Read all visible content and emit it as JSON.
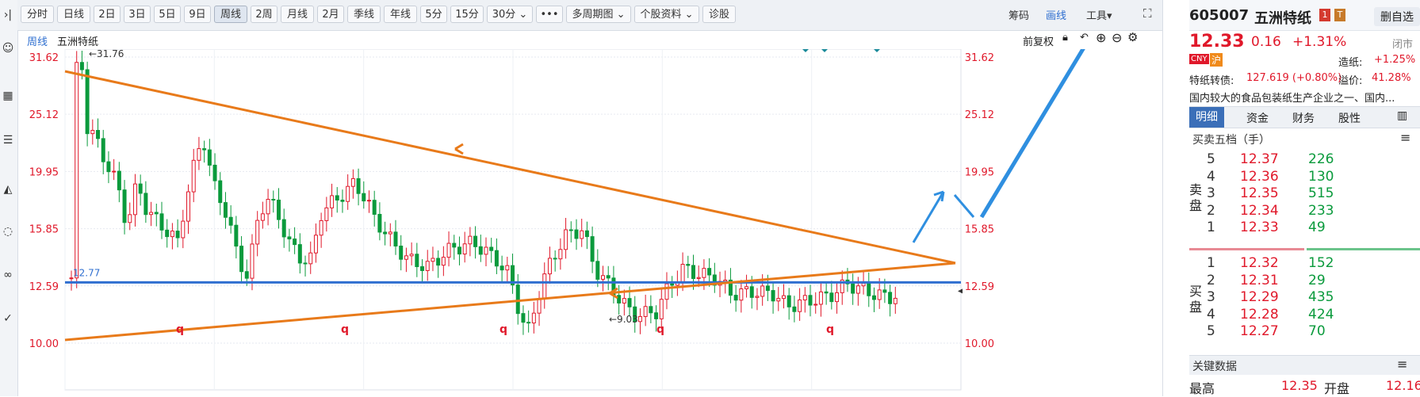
{
  "toolbar": {
    "periods": [
      "分时",
      "日线",
      "2日",
      "3日",
      "5日",
      "9日",
      "周线",
      "2周",
      "月线",
      "2月",
      "季线",
      "年线",
      "5分",
      "15分",
      "30分",
      "多周期图",
      "个股资料",
      "诊股"
    ],
    "more": "•••",
    "right": {
      "code_label": "筹码",
      "draw_label": "画线",
      "tools_label": "工具"
    }
  },
  "chart_header": {
    "period": "周线",
    "name": "五洲特纸",
    "adjust": "前复权"
  },
  "chart_data": {
    "type": "candlestick",
    "y_ticks": [
      "31.62",
      "25.12",
      "19.95",
      "15.85",
      "12.59",
      "10.00"
    ],
    "y_tick_values": [
      31.62,
      25.12,
      19.95,
      15.85,
      12.59,
      10.0
    ],
    "scale": "log",
    "high_label": "←31.76",
    "low_label": "←9.03",
    "hline_label": "12.77",
    "hline_value": 12.77,
    "markers": [
      "q",
      "q",
      "q",
      "q",
      "q"
    ],
    "candles": []
  },
  "stock": {
    "code": "605007",
    "name": "五洲特纸",
    "delete_btn": "删自选",
    "price": "12.33",
    "change": "0.16",
    "change_pct": "+1.31%",
    "status": "闭市",
    "cny": "CNY",
    "market": "沪",
    "paper_label": "造纸:",
    "paper_pct": "+1.25%",
    "bond_label": "特纸转债:",
    "bond_value": "127.619 (+0.80%)",
    "premium_label": "溢价:",
    "premium_value": "41.28%",
    "desc": "国内较大的食品包装纸生产企业之一、国内..."
  },
  "tabs": [
    "明细",
    "资金",
    "财务",
    "股性"
  ],
  "orderbook": {
    "title": "买卖五档（手）",
    "sell_label": "卖盘",
    "buy_label": "买盘",
    "sell": [
      {
        "n": "5",
        "p": "12.37",
        "v": "226"
      },
      {
        "n": "4",
        "p": "12.36",
        "v": "130"
      },
      {
        "n": "3",
        "p": "12.35",
        "v": "515"
      },
      {
        "n": "2",
        "p": "12.34",
        "v": "233"
      },
      {
        "n": "1",
        "p": "12.33",
        "v": "49"
      }
    ],
    "buy": [
      {
        "n": "1",
        "p": "12.32",
        "v": "152"
      },
      {
        "n": "2",
        "p": "12.31",
        "v": "29"
      },
      {
        "n": "3",
        "p": "12.29",
        "v": "435"
      },
      {
        "n": "4",
        "p": "12.28",
        "v": "424"
      },
      {
        "n": "5",
        "p": "12.27",
        "v": "70"
      }
    ]
  },
  "key_data": {
    "title": "关键数据",
    "high_label": "最高",
    "high_value": "12.35",
    "open_label": "开盘",
    "open_value": "12.16"
  },
  "colors": {
    "up": "#e0182a",
    "down": "#0a9a3c",
    "trend": "#e87a1a",
    "hline": "#2f6fd0",
    "arrow": "#2f8fe0"
  }
}
